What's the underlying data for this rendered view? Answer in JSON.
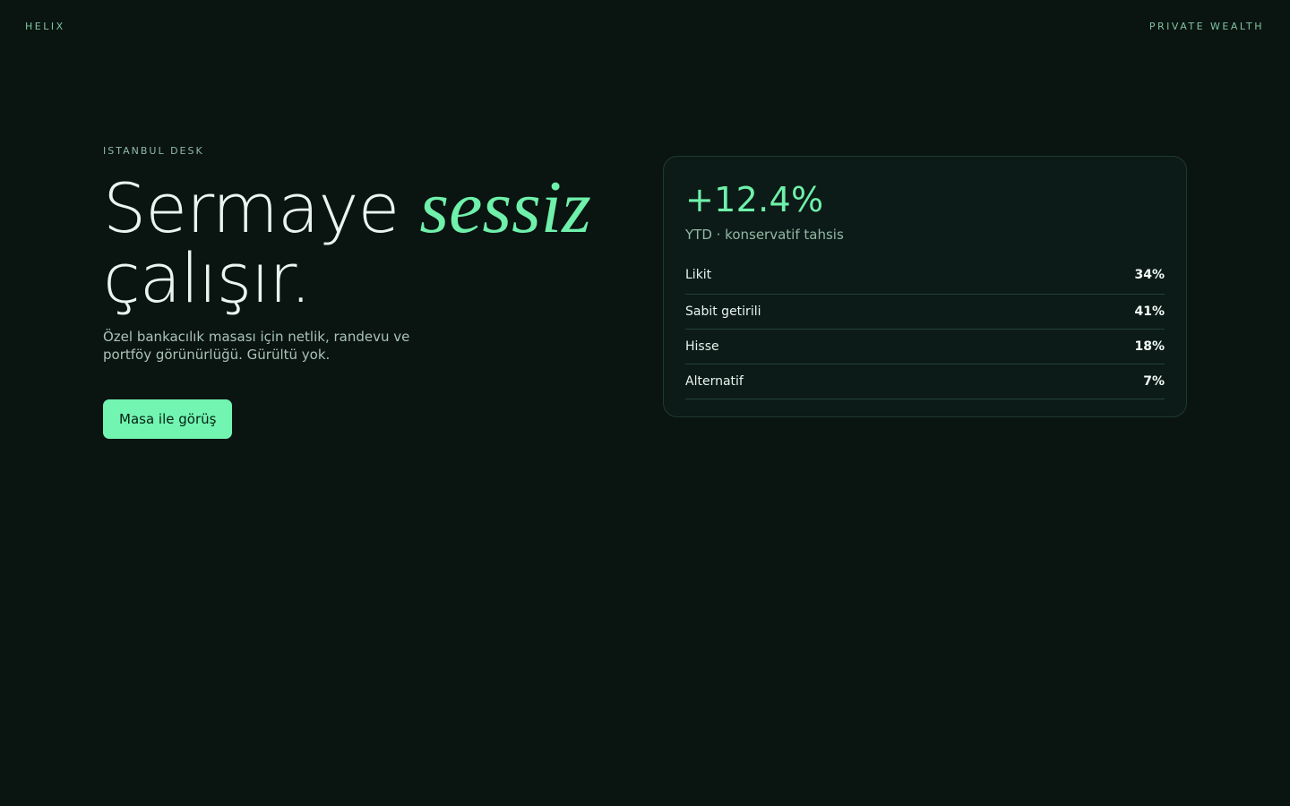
{
  "header": {
    "brand": "HELIX",
    "tagline": "PRIVATE WEALTH"
  },
  "hero": {
    "eyebrow": "ISTANBUL DESK",
    "headline_start": "Sermaye ",
    "headline_accent": "sessiz",
    "headline_end": "çalışır.",
    "lede": "Özel bankacılık masası için netlik, randevu ve portföy görünürlüğü. Gürültü yok.",
    "cta_label": "Masa ile görüş"
  },
  "card": {
    "metric": "+12.4%",
    "metric_caption": "YTD · konservatif tahsis",
    "allocations": [
      {
        "label": "Likit",
        "value": "34%"
      },
      {
        "label": "Sabit getirili",
        "value": "41%"
      },
      {
        "label": "Hisse",
        "value": "18%"
      },
      {
        "label": "Alternatif",
        "value": "7%"
      }
    ]
  },
  "colors": {
    "background": "#0a1411",
    "accent": "#6ff0ab",
    "cta": "#71f5b0"
  }
}
